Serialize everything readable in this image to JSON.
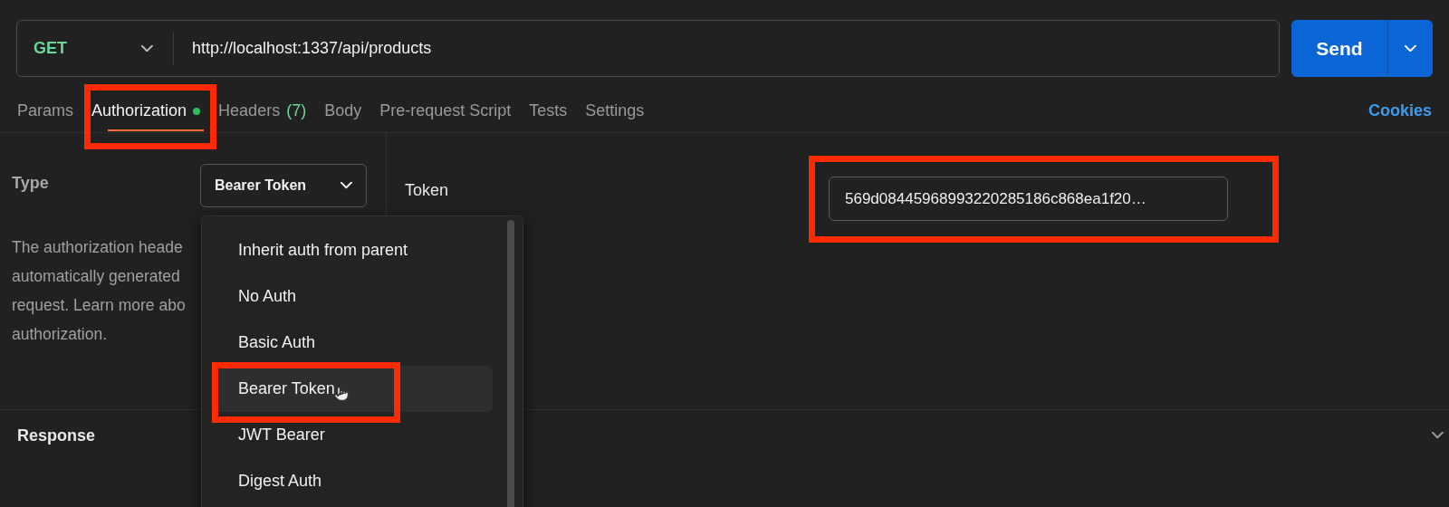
{
  "request": {
    "method": "GET",
    "url": "http://localhost:1337/api/products",
    "send": "Send"
  },
  "tabs": [
    {
      "label": "Params",
      "selected": false,
      "dot": false,
      "highlighted": false
    },
    {
      "label": "Authorization",
      "selected": true,
      "dot": true,
      "highlighted": true
    },
    {
      "label": "Headers",
      "count": "(7)",
      "selected": false,
      "dot": false,
      "highlighted": false
    },
    {
      "label": "Body",
      "selected": false,
      "dot": false,
      "highlighted": false
    },
    {
      "label": "Pre-request Script",
      "selected": false,
      "dot": false,
      "highlighted": false
    },
    {
      "label": "Tests",
      "selected": false,
      "dot": false,
      "highlighted": false
    },
    {
      "label": "Settings",
      "selected": false,
      "dot": false,
      "highlighted": false
    }
  ],
  "cookies": "Cookies",
  "auth": {
    "type_label": "Type",
    "type_value": "Bearer Token",
    "description_lines": [
      "The authorization heade",
      "automatically generated",
      "request. Learn more abo",
      "authorization."
    ],
    "token_label": "Token",
    "token_value": "569d08445968993220285186c868ea1f20…",
    "token_highlighted": true
  },
  "type_menu": [
    {
      "label": "Inherit auth from parent",
      "selected": false,
      "highlighted": false
    },
    {
      "label": "No Auth",
      "selected": false,
      "highlighted": false
    },
    {
      "label": "Basic Auth",
      "selected": false,
      "highlighted": false
    },
    {
      "label": "Bearer Token",
      "selected": true,
      "highlighted": true
    },
    {
      "label": "JWT Bearer",
      "selected": false,
      "highlighted": false
    },
    {
      "label": "Digest Auth",
      "selected": false,
      "highlighted": false
    }
  ],
  "response": {
    "title": "Response"
  }
}
